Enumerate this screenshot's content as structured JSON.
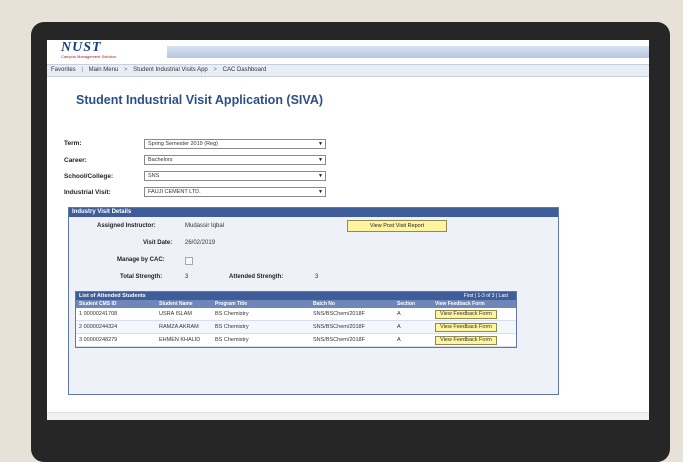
{
  "header": {
    "logo_text": "NUST",
    "logo_subtext": "Campus Management Solution"
  },
  "breadcrumbs": [
    "Favorites",
    "Main Menu",
    "Student Industrial Visits App",
    "CAC Dashboard"
  ],
  "page_title": "Student Industrial Visit Application (SIVA)",
  "form": {
    "term_label": "Term:",
    "term_value": "Spring Semester 2019 (Reg)",
    "career_label": "Career:",
    "career_value": "Bachelors",
    "school_label": "School/College:",
    "school_value": "SNS",
    "visit_label": "Industrial Visit:",
    "visit_value": "FAUJI CEMENT LTD."
  },
  "details": {
    "section_title": "Industry Visit Details",
    "instructor_label": "Assigned Instructor:",
    "instructor_value": "Mudassir Iqbal",
    "report_button": "View Post Visit Report",
    "visit_date_label": "Visit Date:",
    "visit_date_value": "26/02/2019",
    "manage_label": "Manage by CAC:",
    "total_label": "Total Strength:",
    "total_value": "3",
    "attended_label": "Attended Strength:",
    "attended_value": "3"
  },
  "grid": {
    "title": "List of Attended Students",
    "nav": "First | 1-3 of 3 | Last",
    "columns": [
      "Student CMS ID",
      "Student Name",
      "Program Title",
      "Batch No",
      "Section",
      "View Feedback Form"
    ],
    "rows": [
      {
        "idx": "1",
        "cms": "00000241708",
        "name": "USRA ISLAM",
        "program": "BS Chemistry",
        "batch": "SNS/BSChem/2018F",
        "section": "A",
        "action": "View Feedback Form"
      },
      {
        "idx": "2",
        "cms": "00000244324",
        "name": "RAMZA AKRAM",
        "program": "BS Chemistry",
        "batch": "SNS/BSChem/2018F",
        "section": "A",
        "action": "View Feedback Form"
      },
      {
        "idx": "3",
        "cms": "00000248279",
        "name": "EHMEN KHALID",
        "program": "BS Chemistry",
        "batch": "SNS/BSChem/2018F",
        "section": "A",
        "action": "View Feedback Form"
      }
    ]
  }
}
